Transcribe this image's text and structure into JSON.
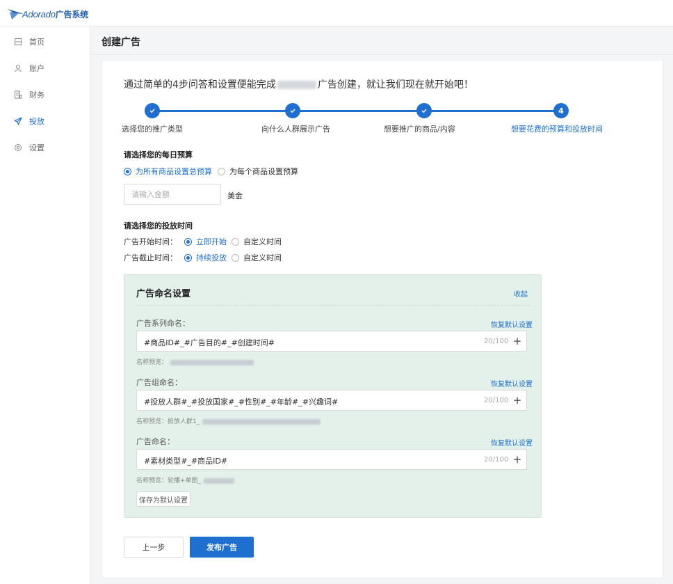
{
  "app": {
    "logo_text": "Adorado",
    "logo_suffix": "广告系统"
  },
  "sidebar": {
    "items": [
      {
        "label": "首页",
        "icon": "home-icon"
      },
      {
        "label": "账户",
        "icon": "user-icon"
      },
      {
        "label": "财务",
        "icon": "finance-icon"
      },
      {
        "label": "投放",
        "icon": "send-icon",
        "active": true
      },
      {
        "label": "设置",
        "icon": "gear-icon"
      }
    ]
  },
  "page": {
    "title": "创建广告"
  },
  "intro": {
    "before": "通过简单的4步问答和设置便能完成",
    "after": "广告创建，就让我们现在就开始吧！"
  },
  "steps": [
    {
      "label": "选择您的推广类型",
      "done": true
    },
    {
      "label": "向什么人群展示广告",
      "done": true
    },
    {
      "label": "想要推广的商品/内容",
      "done": true
    },
    {
      "label": "想要花费的预算和投放时间",
      "number": "4",
      "current": true
    }
  ],
  "budget": {
    "title": "请选择您的每日预算",
    "options": [
      "为所有商品设置总预算",
      "为每个商品设置预算"
    ],
    "selected": 0,
    "amount_placeholder": "请输入金额",
    "unit": "美金"
  },
  "schedule": {
    "title": "请选择您的投放时间",
    "start_label": "广告开始时间：",
    "start_options": [
      "立即开始",
      "自定义时间"
    ],
    "end_label": "广告截止时间：",
    "end_options": [
      "持续投放",
      "自定义时间"
    ]
  },
  "naming": {
    "title": "广告命名设置",
    "collapse": "收起",
    "reset": "恢复默认设置",
    "preview_label": "名称预览：",
    "campaign": {
      "label": "广告系列命名：",
      "value": "#商品ID#_#广告目的#_#创建时间#",
      "count": "20/100"
    },
    "adset": {
      "label": "广告组命名：",
      "value": "#投放人群#_#投放国家#_#性别#_#年龄#_#兴趣词#",
      "count": "20/100",
      "preview_prefix": "投放人群1_"
    },
    "ad": {
      "label": "广告命名：",
      "value": "#素材类型#_#商品ID#",
      "count": "20/100",
      "preview_prefix": "轮播+单图_"
    },
    "save_default": "保存为默认设置"
  },
  "actions": {
    "prev": "上一步",
    "publish": "发布广告"
  },
  "colors": {
    "primary": "#1f6fd1",
    "naming_bg": "#e3f1ea"
  }
}
